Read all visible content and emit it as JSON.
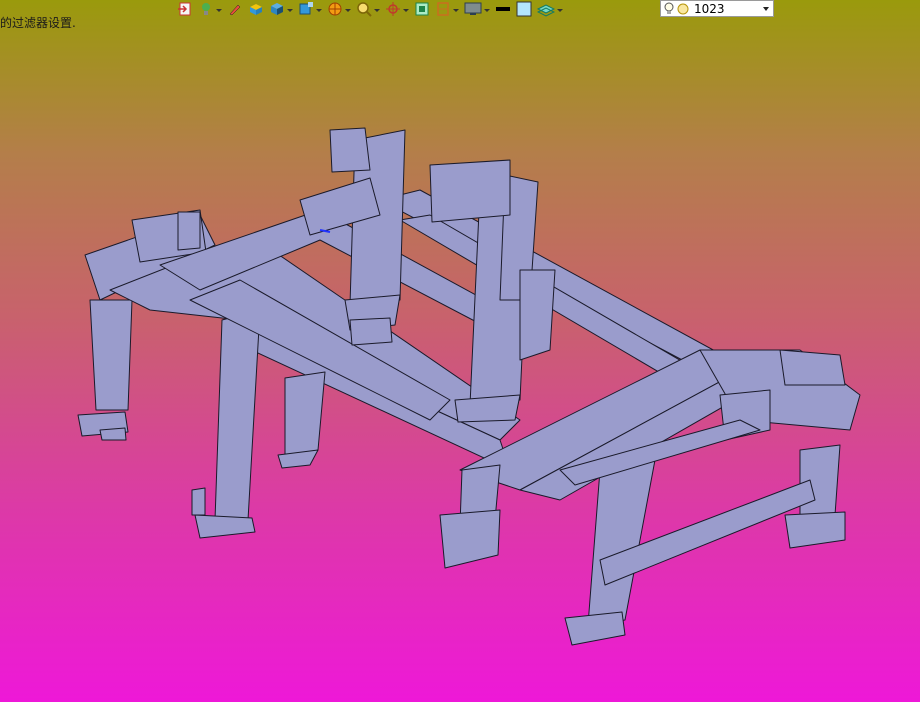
{
  "status": {
    "message": "的过滤器设置."
  },
  "toolbar": {
    "icons": [
      "import-icon",
      "lamp-icon",
      "pen-icon",
      "box-icon",
      "cube-icon",
      "cube-view-icon",
      "render-icon",
      "zoom-icon",
      "axis-icon",
      "frame-icon",
      "section-icon",
      "display-icon",
      "line-color-icon",
      "fill-color-icon",
      "layer-icon"
    ],
    "entity_count": "1023"
  },
  "viewport": {
    "model_color": "#9a9ccc",
    "edge_color": "#1a1a2a",
    "background_top": "#9a9a0c",
    "background_bottom": "#ee18d8"
  }
}
